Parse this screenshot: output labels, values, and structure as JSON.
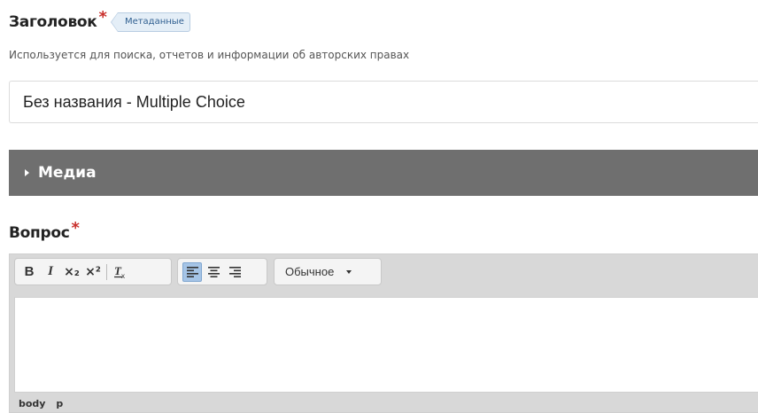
{
  "title_field": {
    "label": "Заголовок",
    "required_mark": "*",
    "metadata_tag": "Метаданные",
    "description": "Используется для поиска, отчетов и информации об авторских правах",
    "value": "Без названия - Multiple Choice"
  },
  "media_section": {
    "label": "Медиа",
    "state": "collapsed"
  },
  "question_field": {
    "label": "Вопрос",
    "required_mark": "*",
    "toolbar": {
      "bold": "B",
      "italic": "I",
      "subscript": "×₂",
      "superscript": "×²",
      "remove_format": "Ix",
      "format_select": "Обычное",
      "active_alignment": "align-left"
    },
    "element_path": [
      "body",
      "p"
    ]
  },
  "colors": {
    "media_bar": "#6f6f6f",
    "required": "#c9302c",
    "metadata_tag_text": "#2f5f90",
    "active_button": "#a5c4e6"
  }
}
